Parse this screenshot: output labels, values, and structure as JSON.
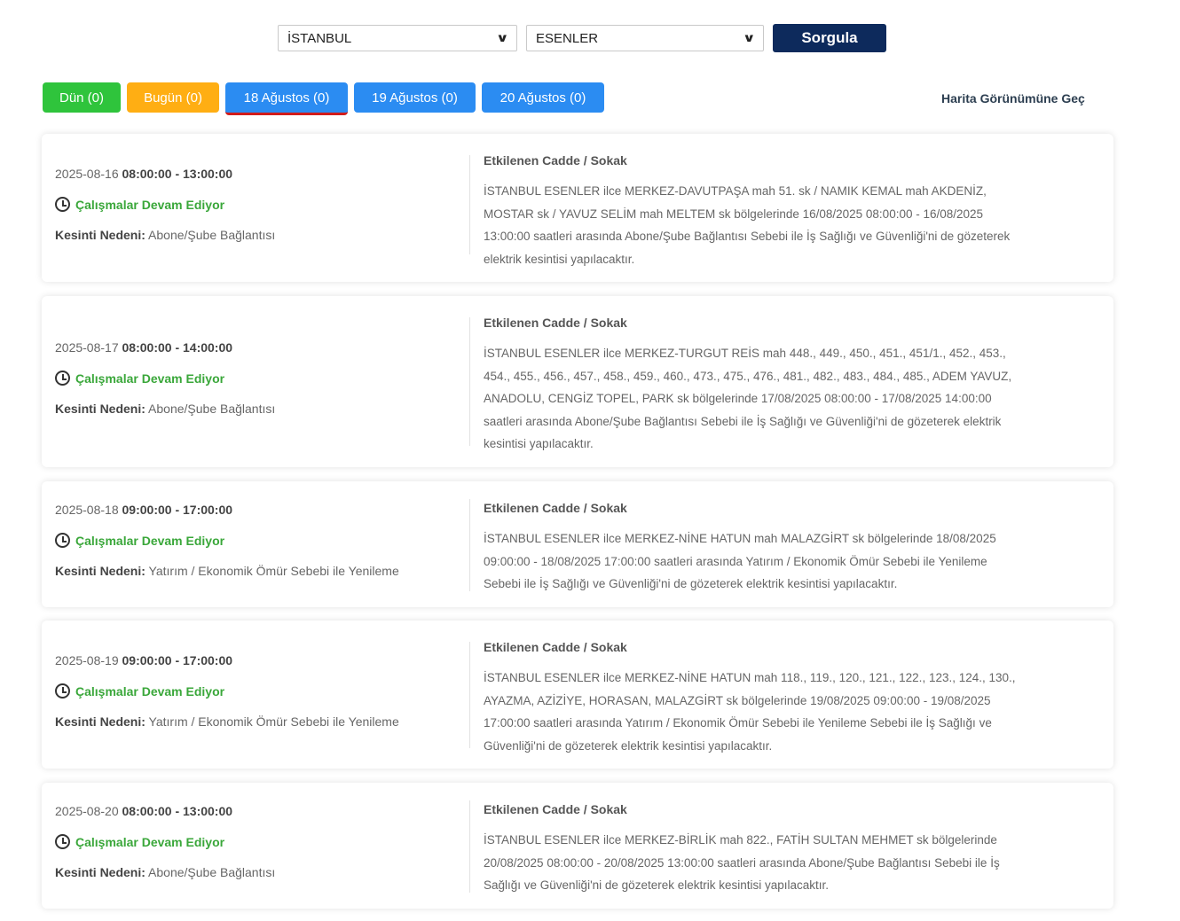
{
  "filters": {
    "city": "İSTANBUL",
    "district": "ESENLER",
    "query_button": "Sorgula"
  },
  "tabs": [
    {
      "label": "Dün (0)"
    },
    {
      "label": "Bugün (0)"
    },
    {
      "label": "18 Ağustos (0)"
    },
    {
      "label": "19 Ağustos (0)"
    },
    {
      "label": "20 Ağustos (0)"
    }
  ],
  "map_link": "Harita Görünümüne Geç",
  "labels": {
    "status": "Çalışmalar Devam Ediyor",
    "reason_label": "Kesinti Nedeni:",
    "affected_title": "Etkilenen Cadde / Sokak"
  },
  "outages": [
    {
      "date": "2025-08-16",
      "time": "08:00:00 - 13:00:00",
      "reason": "Abone/Şube Bağlantısı",
      "affected": "İSTANBUL ESENLER ilce MERKEZ-DAVUTPAŞA mah 51. sk / NAMIK KEMAL mah AKDENİZ, MOSTAR sk / YAVUZ SELİM mah MELTEM sk bölgelerinde 16/08/2025 08:00:00 - 16/08/2025 13:00:00 saatleri arasında Abone/Şube Bağlantısı Sebebi ile İş Sağlığı ve Güvenliği'ni de gözeterek elektrik kesintisi yapılacaktır."
    },
    {
      "date": "2025-08-17",
      "time": "08:00:00 - 14:00:00",
      "reason": "Abone/Şube Bağlantısı",
      "affected": "İSTANBUL ESENLER ilce MERKEZ-TURGUT REİS mah 448., 449., 450., 451., 451/1., 452., 453., 454., 455., 456., 457., 458., 459., 460., 473., 475., 476., 481., 482., 483., 484., 485., ADEM YAVUZ, ANADOLU, CENGİZ TOPEL, PARK sk bölgelerinde 17/08/2025 08:00:00 - 17/08/2025 14:00:00 saatleri arasında Abone/Şube Bağlantısı Sebebi ile İş Sağlığı ve Güvenliği'ni de gözeterek elektrik kesintisi yapılacaktır."
    },
    {
      "date": "2025-08-18",
      "time": "09:00:00 - 17:00:00",
      "reason": "Yatırım / Ekonomik Ömür Sebebi ile Yenileme",
      "affected": "İSTANBUL ESENLER ilce MERKEZ-NİNE HATUN mah MALAZGİRT sk bölgelerinde 18/08/2025 09:00:00 - 18/08/2025 17:00:00 saatleri arasında Yatırım / Ekonomik Ömür Sebebi ile Yenileme Sebebi ile İş Sağlığı ve Güvenliği'ni de gözeterek elektrik kesintisi yapılacaktır."
    },
    {
      "date": "2025-08-19",
      "time": "09:00:00 - 17:00:00",
      "reason": "Yatırım / Ekonomik Ömür Sebebi ile Yenileme",
      "affected": "İSTANBUL ESENLER ilce MERKEZ-NİNE HATUN mah 118., 119., 120., 121., 122., 123., 124., 130., AYAZMA, AZİZİYE, HORASAN, MALAZGİRT sk bölgelerinde 19/08/2025 09:00:00 - 19/08/2025 17:00:00 saatleri arasında Yatırım / Ekonomik Ömür Sebebi ile Yenileme Sebebi ile İş Sağlığı ve Güvenliği'ni de gözeterek elektrik kesintisi yapılacaktır."
    },
    {
      "date": "2025-08-20",
      "time": "08:00:00 - 13:00:00",
      "reason": "Abone/Şube Bağlantısı",
      "affected": "İSTANBUL ESENLER ilce MERKEZ-BİRLİK mah 822., FATİH SULTAN MEHMET sk bölgelerinde 20/08/2025 08:00:00 - 20/08/2025 13:00:00 saatleri arasında Abone/Şube Bağlantısı Sebebi ile İş Sağlığı ve Güvenliği'ni de gözeterek elektrik kesintisi yapılacaktır."
    }
  ],
  "colors": {
    "tab_green": "#2fc43c",
    "tab_orange": "#ffae13",
    "tab_blue": "#2b8cf2",
    "active_underline": "#d11c1c",
    "query_button": "#0d2a5c",
    "status_green": "#3aa73a"
  }
}
